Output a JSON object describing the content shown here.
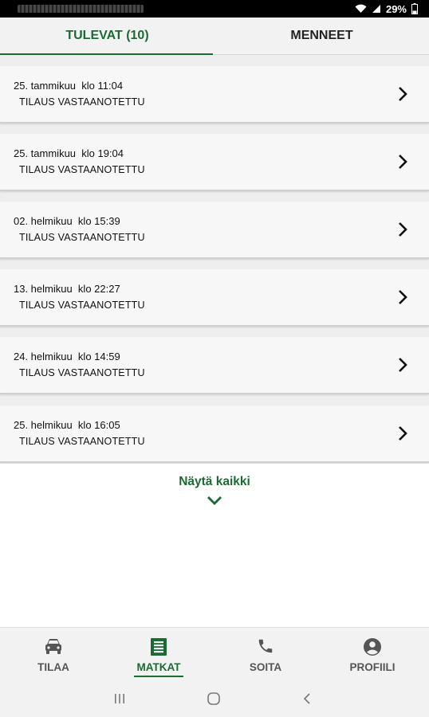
{
  "status_bar": {
    "battery": "29%"
  },
  "tabs": [
    {
      "label": "TULEVAT (10)",
      "active": true
    },
    {
      "label": "MENNEET",
      "active": false
    }
  ],
  "orders": [
    {
      "date": "25. tammikuu  klo 11:04",
      "status": "TILAUS VASTAANOTETTU"
    },
    {
      "date": "25. tammikuu  klo 19:04",
      "status": "TILAUS VASTAANOTETTU"
    },
    {
      "date": "02. helmikuu  klo 15:39",
      "status": "TILAUS VASTAANOTETTU"
    },
    {
      "date": "13. helmikuu  klo 22:27",
      "status": "TILAUS VASTAANOTETTU"
    },
    {
      "date": "24. helmikuu  klo 14:59",
      "status": "TILAUS VASTAANOTETTU"
    },
    {
      "date": "25. helmikuu  klo 16:05",
      "status": "TILAUS VASTAANOTETTU"
    }
  ],
  "show_all": {
    "label": "Näytä kaikki",
    "icon": "chevron-down-icon"
  },
  "bottom_nav": [
    {
      "label": "TILAA",
      "icon": "car-icon",
      "active": false
    },
    {
      "label": "MATKAT",
      "icon": "receipt-icon",
      "active": true
    },
    {
      "label": "SOITA",
      "icon": "phone-icon",
      "active": false
    },
    {
      "label": "PROFIILI",
      "icon": "account-circle-icon",
      "active": false
    }
  ],
  "colors": {
    "accent": "#1a6b33",
    "tab_background": "#f2f2f2",
    "card_background": "#f7f7f7"
  }
}
